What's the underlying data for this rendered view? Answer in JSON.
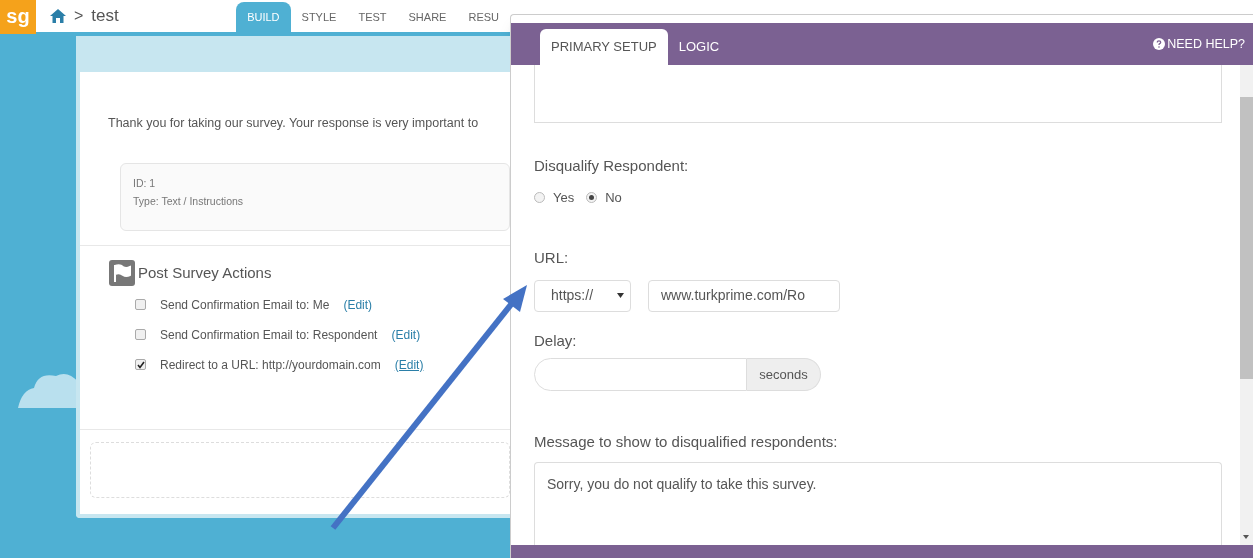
{
  "app_bar": {
    "logo": "sg",
    "separator": ">",
    "project": "test",
    "tabs": [
      {
        "label": "BUILD",
        "selected": true
      },
      {
        "label": "STYLE",
        "selected": false
      },
      {
        "label": "TEST",
        "selected": false
      },
      {
        "label": "SHARE",
        "selected": false
      },
      {
        "label": "RESU",
        "selected": false
      }
    ]
  },
  "survey_page": {
    "intro": "Thank you for taking our survey. Your response is very important to",
    "question": {
      "id": "ID: 1",
      "type": "Type: Text / Instructions"
    },
    "post_survey_actions": {
      "title": "Post Survey Actions",
      "items": [
        {
          "label": "Send Confirmation Email to: Me",
          "checked": false,
          "link": "(Edit)",
          "underlined": false
        },
        {
          "label": "Send Confirmation Email to: Respondent",
          "checked": false,
          "link": "(Edit)",
          "underlined": false
        },
        {
          "label": "Redirect to a URL: http://yourdomain.com",
          "checked": true,
          "link": "(Edit)",
          "underlined": true
        }
      ]
    }
  },
  "modal": {
    "tabs": [
      {
        "label": "PRIMARY SETUP",
        "selected": true
      },
      {
        "label": "LOGIC",
        "selected": false
      }
    ],
    "help": "NEED HELP?",
    "disqualify": {
      "label": "Disqualify Respondent:",
      "options": [
        {
          "label": "Yes",
          "selected": false
        },
        {
          "label": "No",
          "selected": true
        }
      ]
    },
    "url": {
      "label": "URL:",
      "protocol": "https://",
      "value": "www.turkprime.com/Ro"
    },
    "delay": {
      "label": "Delay:",
      "unit": "seconds"
    },
    "message": {
      "label": "Message to show to disqualified respondents:",
      "value": "Sorry, you do not qualify to take this survey."
    }
  }
}
